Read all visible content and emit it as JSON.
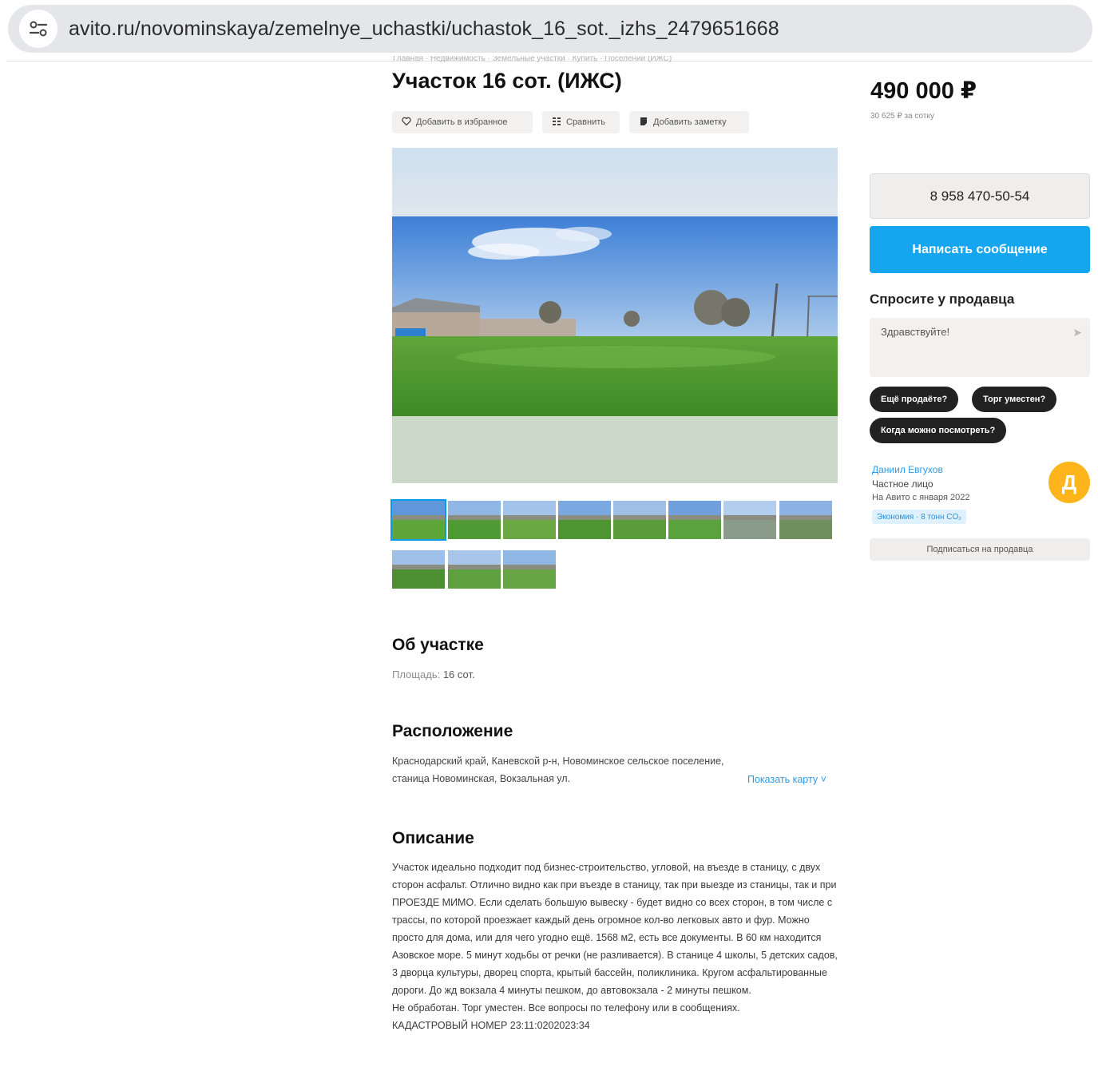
{
  "browser": {
    "url": "avito.ru/novominskaya/zemelnye_uchastki/uchastok_16_sot._izhs_2479651668",
    "site_info_icon": "tune-icon"
  },
  "breadcrumbs": "Главная · Недвижимость · Земельные участки · Купить · Поселений (ИЖС)",
  "listing": {
    "title": "Участок 16 сот. (ИЖС)",
    "actions": {
      "favorite": "Добавить в избранное",
      "compare": "Сравнить",
      "note": "Добавить заметку"
    },
    "photo_count": 11
  },
  "about": {
    "heading": "Об участке",
    "area_label": "Площадь:",
    "area_value": "16 сот."
  },
  "location": {
    "heading": "Расположение",
    "address": "Краснодарский край, Каневской р-н, Новоминское сельское поселение, станица Новоминская, Вокзальная ул.",
    "map_link": "Показать карту ˅"
  },
  "description": {
    "heading": "Описание",
    "text": "Участок идеально подходит под бизнес-строительство, угловой, на въезде в станицу, с двух сторон асфальт. Отлично видно как при въезде в станицу, так при выезде из станицы, так и при ПРОЕЗДЕ МИМО. Если сделать большую вывеску - будет видно со всех сторон, в том числе с трассы, по которой проезжает каждый день огромное кол-во легковых авто и фур. Можно просто для дома, или для чего угодно ещё. 1568 м2, есть все документы. В 60 км находится Азовское море. 5 минут ходьбы от речки (не разливается). В станице 4 школы, 5 детских садов, 3 дворца культуры, дворец спорта, крытый бассейн, поликлиника. Кругом асфальтированные дороги. До жд вокзала 4 минуты пешком, до автовокзала - 2 минуты пешком.",
    "extra": "Не обработан. Торг уместен. Все вопросы по телефону или в сообщениях.",
    "cadastral": "КАДАСТРОВЫЙ НОМЕР 23:11:0202023:34"
  },
  "sidebar": {
    "price": "490 000 ₽",
    "price_per_unit": "30 625 ₽ за сотку",
    "phone": "8 958 470-50-54",
    "message_button": "Написать сообщение",
    "ask_title": "Спросите у продавца",
    "ask_placeholder": "Здравствуйте!",
    "quick_questions": [
      "Ещё продаёте?",
      "Торг уместен?",
      "Когда можно посмотреть?"
    ],
    "seller": {
      "name": "Даниил Евгухов",
      "type": "Частное лицо",
      "since": "На Авито с января 2022",
      "eco_badge": "Экономия · 8 тонн CO₂",
      "avatar_letter": "Д"
    },
    "subscribe_button": "Подписаться на продавца"
  },
  "colors": {
    "accent": "#16a6f0",
    "avatar": "#fdb51b",
    "link": "#2f9be3"
  }
}
